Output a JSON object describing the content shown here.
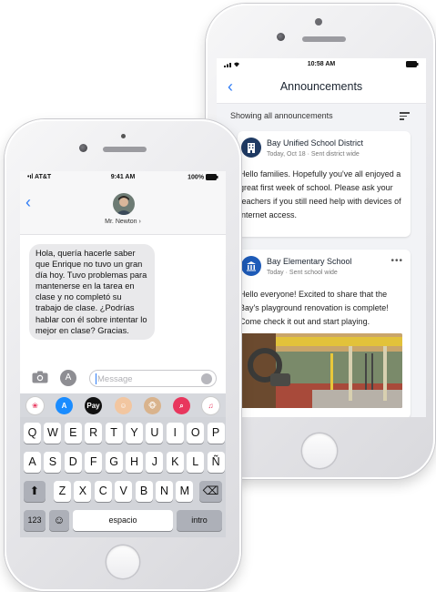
{
  "announcements_phone": {
    "status_bar": {
      "time": "10:58 AM",
      "signal": "📶",
      "battery": "▬"
    },
    "nav": {
      "back": "‹",
      "title": "Announcements"
    },
    "filter_text": "Showing all announcements",
    "posts": [
      {
        "author": "Bay Unified School District",
        "meta": "Today, Oct 18 · Sent district wide",
        "body": "Hello families. Hopefully you've all enjoyed a great first week of school. Please ask your teachers if you still need help with devices of internet access.",
        "icon": "building-icon"
      },
      {
        "author": "Bay Elementary School",
        "meta": "Today · Sent school wide",
        "body": "Hello everyone! Excited to share that the Bay's playground renovation is complete! Come check it out and start playing.",
        "more": "•••",
        "icon": "school-icon"
      }
    ]
  },
  "messages_phone": {
    "status_bar": {
      "carrier": "AT&T",
      "time": "9:41 AM",
      "battery": "100%"
    },
    "nav": {
      "back": "‹",
      "contact": "Mr. Newton ›"
    },
    "message": "Hola, quería hacerle saber que Enrique no tuvo un gran día hoy. Tuvo problemas para mantenerse en la tarea en clase y no completó su trabajo de clase. ¿Podrías hablar con él sobre intentar lo mejor en clase? Gracias.",
    "input_placeholder": "Message",
    "app_strip": [
      {
        "name": "photos-app-icon",
        "glyph": "❀",
        "color": "#ffffff"
      },
      {
        "name": "appstore-app-icon",
        "glyph": "A",
        "color": "#1a8cff"
      },
      {
        "name": "applepay-app-icon",
        "glyph": "Pay",
        "color": "#111111"
      },
      {
        "name": "memoji-app-icon",
        "glyph": "☺",
        "color": "#f2c6a0"
      },
      {
        "name": "animoji-app-icon",
        "glyph": "🐵",
        "color": "#d9b38c"
      },
      {
        "name": "search-app-icon",
        "glyph": "⌕",
        "color": "#e8365d"
      },
      {
        "name": "music-app-icon",
        "glyph": "♫",
        "color": "#ffffff"
      }
    ],
    "keyboard": {
      "row1": [
        "Q",
        "W",
        "E",
        "R",
        "T",
        "Y",
        "U",
        "I",
        "O",
        "P"
      ],
      "row2": [
        "A",
        "S",
        "D",
        "F",
        "G",
        "H",
        "J",
        "K",
        "L",
        "Ñ"
      ],
      "row3": [
        "Z",
        "X",
        "C",
        "V",
        "B",
        "N",
        "M"
      ],
      "shift": "⬆",
      "delete": "⌫",
      "numbers": "123",
      "emoji": "☺",
      "space": "espacio",
      "enter": "intro"
    }
  }
}
